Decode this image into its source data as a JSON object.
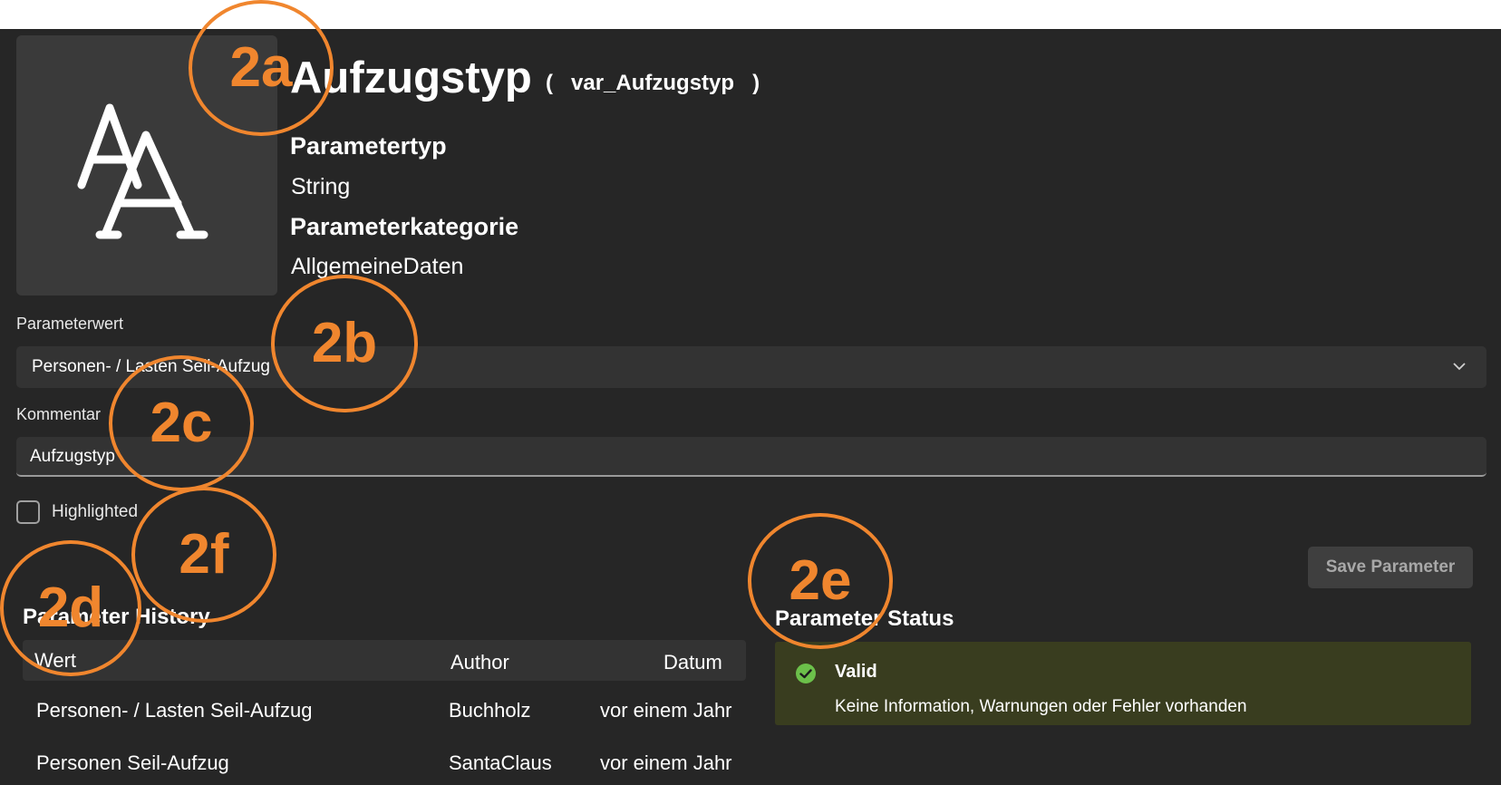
{
  "parameter": {
    "title": "Aufzugstyp",
    "var_open": "(",
    "var_name": "var_Aufzugstyp",
    "var_close": ")",
    "type_label": "Parametertyp",
    "type_value": "String",
    "category_label": "Parameterkategorie",
    "category_value": "AllgemeineDaten",
    "icon": "font-size-icon"
  },
  "form": {
    "value_label": "Parameterwert",
    "value_selected": "Personen- / Lasten Seil-Aufzug",
    "comment_label": "Kommentar",
    "comment_value": "Aufzugstyp",
    "highlighted_label": "Highlighted",
    "highlighted_checked": false,
    "save_label": "Save Parameter"
  },
  "history": {
    "title": "Parameter History",
    "columns": [
      "Wert",
      "Author",
      "Datum"
    ],
    "rows": [
      [
        "Personen- / Lasten Seil-Aufzug",
        "Buchholz",
        "vor einem Jahr"
      ],
      [
        "Personen Seil-Aufzug",
        "SantaClaus",
        "vor einem Jahr"
      ]
    ]
  },
  "status": {
    "title": "Parameter Status",
    "state": "Valid",
    "message": "Keine Information, Warnungen oder Fehler vorhanden",
    "color": "#393d1f",
    "icon": "check-circle-icon"
  },
  "annotations": [
    "2a",
    "2b",
    "2c",
    "2d",
    "2e",
    "2f"
  ],
  "colors": {
    "background": "#262626",
    "annotation": "#f0862e",
    "valid_icon": "#6cc04a"
  }
}
